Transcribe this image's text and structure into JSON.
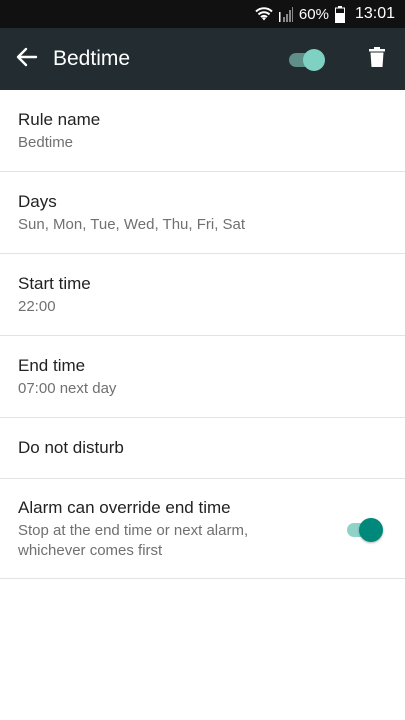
{
  "status_bar": {
    "battery_percent": "60%",
    "time": "13:01",
    "icons": [
      "wifi-icon",
      "signal-icon",
      "battery-icon"
    ]
  },
  "app_bar": {
    "back_icon": "arrow-left-icon",
    "title": "Bedtime",
    "rule_enabled": true,
    "delete_icon": "trash-icon"
  },
  "settings": {
    "rule_name": {
      "label": "Rule name",
      "value": "Bedtime"
    },
    "days": {
      "label": "Days",
      "value": "Sun, Mon, Tue, Wed, Thu, Fri, Sat"
    },
    "start_time": {
      "label": "Start time",
      "value": "22:00"
    },
    "end_time": {
      "label": "End time",
      "value": "07:00 next day"
    },
    "do_not_disturb": {
      "label": "Do not disturb"
    },
    "alarm_override": {
      "label": "Alarm can override end time",
      "description": "Stop at the end time or next alarm, whichever comes first",
      "enabled": true
    }
  },
  "colors": {
    "app_bar": "#232c30",
    "status_bar": "#111111",
    "accent": "#00897b",
    "accent_light": "#8fd3c8"
  }
}
